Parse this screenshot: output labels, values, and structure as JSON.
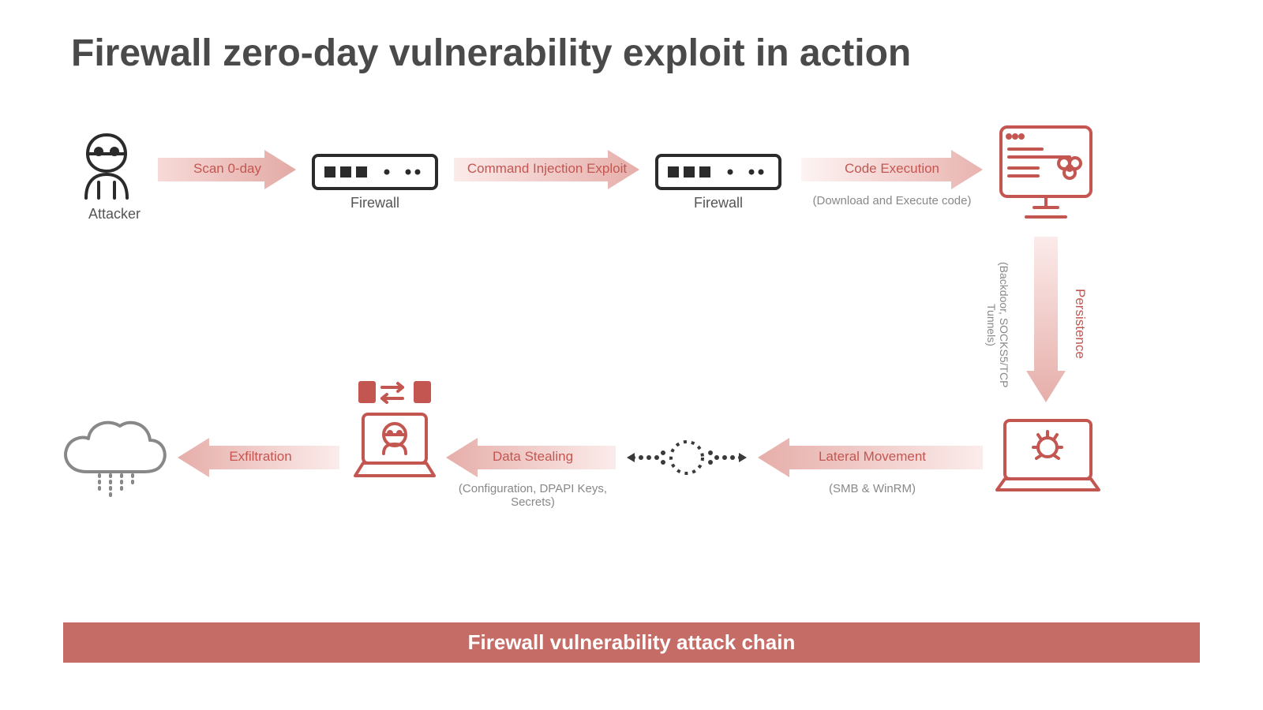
{
  "title": "Firewall zero-day vulnerability exploit in action",
  "footer": "Firewall vulnerability attack chain",
  "nodes": {
    "attacker": {
      "label": "Attacker"
    },
    "firewall1": {
      "label": "Firewall"
    },
    "firewall2": {
      "label": "Firewall"
    },
    "infected_host": {
      "label": ""
    },
    "compromised_laptop": {
      "label": ""
    },
    "lateral_network": {
      "label": ""
    },
    "data_theft_station": {
      "label": ""
    },
    "cloud": {
      "label": ""
    }
  },
  "arrows": {
    "scan": {
      "label": "Scan 0-day",
      "sub": ""
    },
    "inject": {
      "label": "Command Injection Exploit",
      "sub": ""
    },
    "codeexec": {
      "label": "Code Execution",
      "sub": "(Download and Execute code)"
    },
    "persistence": {
      "label": "Persistence",
      "sub": "(Backdoor, SOCKS5/TCP Tunnels)"
    },
    "lateral": {
      "label": "Lateral Movement",
      "sub": "(SMB & WinRM)"
    },
    "steal": {
      "label": "Data Stealing",
      "sub": "(Configuration, DPAPI Keys, Secrets)"
    },
    "exfil": {
      "label": "Exfiltration",
      "sub": ""
    }
  }
}
